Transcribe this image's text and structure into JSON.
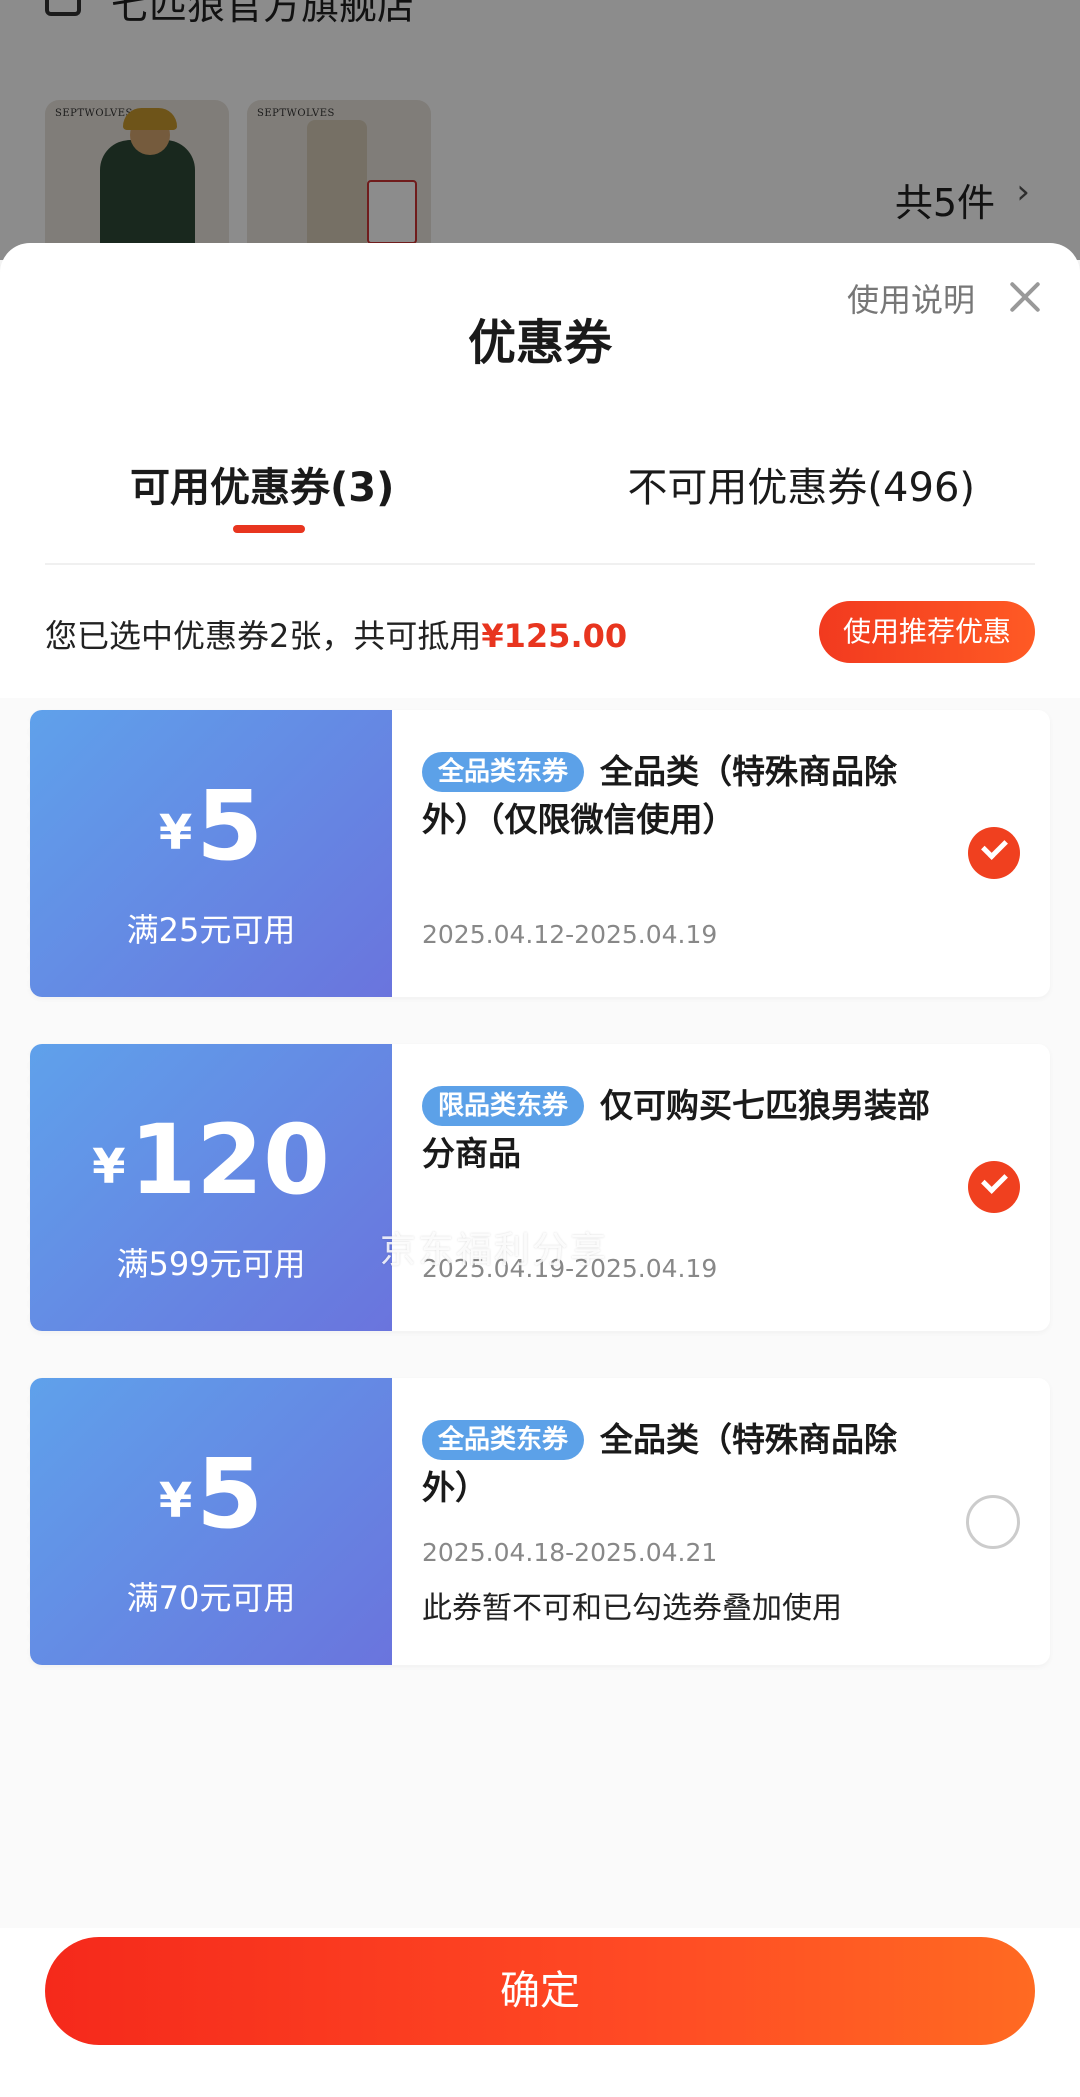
{
  "background": {
    "store_name": "七匹狼官方旗舰店",
    "product_brand": "SEPTWOLVES",
    "total_count": "共5件",
    "arrow": "›"
  },
  "sheet": {
    "title": "优惠券",
    "help_link": "使用说明",
    "tabs": [
      {
        "label": "可用优惠券(3)",
        "active": true
      },
      {
        "label": "不可用优惠券(496)",
        "active": false
      }
    ],
    "summary_text": "您已选中优惠券2张，共可抵用",
    "summary_amount": "¥125.00",
    "recommend_button": "使用推荐优惠"
  },
  "coupons": [
    {
      "currency": "¥",
      "amount": "5",
      "threshold": "满25元可用",
      "badge": "全品类东券",
      "title": "全品类（特殊商品除外）（仅限微信使用）",
      "date": "2025.04.12-2025.04.19",
      "note": "",
      "selected": true
    },
    {
      "currency": "¥",
      "amount": "120",
      "threshold": "满599元可用",
      "badge": "限品类东券",
      "title": "仅可购买七匹狼男装部分商品",
      "date": "2025.04.19-2025.04.19",
      "note": "",
      "selected": true
    },
    {
      "currency": "¥",
      "amount": "5",
      "threshold": "满70元可用",
      "badge": "全品类东券",
      "title": "全品类（特殊商品除外）",
      "date": "2025.04.18-2025.04.21",
      "note": "此券暂不可和已勾选券叠加使用",
      "selected": false
    }
  ],
  "watermark": "京东福利分享",
  "confirm_button": "确定",
  "colors": {
    "accent": "#e8351f",
    "coupon_blue_start": "#5fa1eb",
    "coupon_blue_end": "#6a74dd",
    "badge_blue": "#5ca1e8"
  },
  "icons": [
    "store-icon",
    "close-icon",
    "check-icon",
    "chevron-right-icon"
  ]
}
